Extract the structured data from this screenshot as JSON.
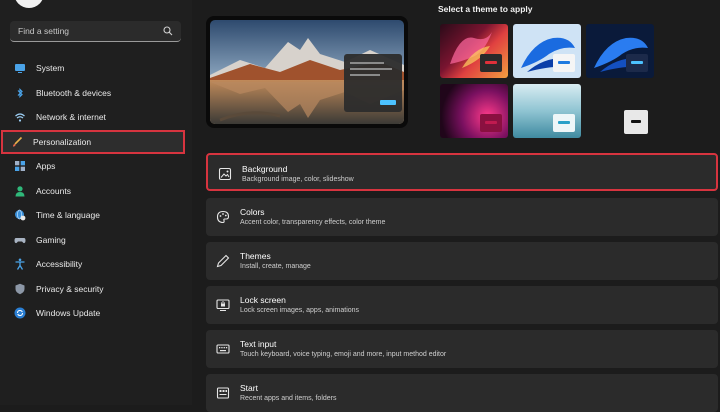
{
  "search": {
    "placeholder": "Find a setting",
    "icon": "search-icon"
  },
  "nav": {
    "items": [
      {
        "label": "System",
        "icon": "monitor-icon"
      },
      {
        "label": "Bluetooth & devices",
        "icon": "bluetooth-icon"
      },
      {
        "label": "Network & internet",
        "icon": "wifi-icon"
      },
      {
        "label": "Personalization",
        "icon": "brush-icon",
        "active": true
      },
      {
        "label": "Apps",
        "icon": "apps-icon"
      },
      {
        "label": "Accounts",
        "icon": "person-icon"
      },
      {
        "label": "Time & language",
        "icon": "globe-clock-icon"
      },
      {
        "label": "Gaming",
        "icon": "gamepad-icon"
      },
      {
        "label": "Accessibility",
        "icon": "accessibility-icon"
      },
      {
        "label": "Privacy & security",
        "icon": "shield-icon"
      },
      {
        "label": "Windows Update",
        "icon": "update-icon"
      }
    ]
  },
  "themes": {
    "title": "Select a theme to apply"
  },
  "cards": [
    {
      "title": "Background",
      "subtitle": "Background image, color, slideshow",
      "icon": "image-icon"
    },
    {
      "title": "Colors",
      "subtitle": "Accent color, transparency effects, color theme",
      "icon": "palette-icon"
    },
    {
      "title": "Themes",
      "subtitle": "Install, create, manage",
      "icon": "pen-icon"
    },
    {
      "title": "Lock screen",
      "subtitle": "Lock screen images, apps, animations",
      "icon": "lock-screen-icon"
    },
    {
      "title": "Text input",
      "subtitle": "Touch keyboard, voice typing, emoji and more, input method editor",
      "icon": "keyboard-icon"
    },
    {
      "title": "Start",
      "subtitle": "Recent apps and items, folders",
      "icon": "start-icon"
    }
  ],
  "colors": {
    "highlight": "#d7343f",
    "accent": "#4cc2ff"
  }
}
